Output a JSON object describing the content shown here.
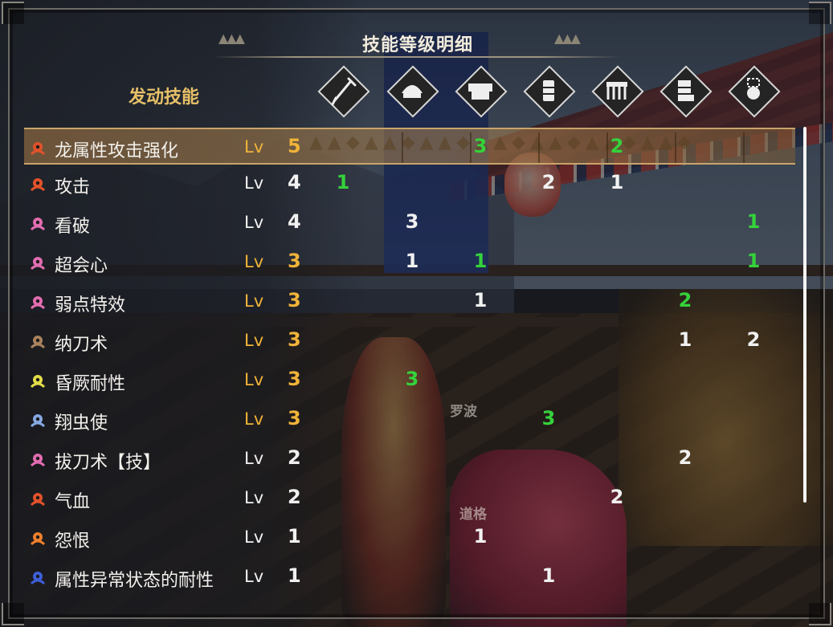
{
  "title": "技能等级明细",
  "section_label": "发动技能",
  "npc_labels": [
    "罗波",
    "道格"
  ],
  "equipment_columns": [
    {
      "icon": "weapon-icon"
    },
    {
      "icon": "helmet-icon"
    },
    {
      "icon": "chest-armor-icon"
    },
    {
      "icon": "arm-armor-icon"
    },
    {
      "icon": "waist-armor-icon"
    },
    {
      "icon": "leg-armor-icon"
    },
    {
      "icon": "talisman-icon"
    }
  ],
  "colors": {
    "level_max": "#f0b339",
    "level_normal": "#f1f1f1",
    "decoration_points": "#35d23b",
    "equipment_points": "#f1f1f1"
  },
  "skills": [
    {
      "name": "龙属性攻击强化",
      "lv_label": "Lv",
      "level": "5",
      "level_style": "gold",
      "icon_color": "#e2522a",
      "highlight": true,
      "points": [
        {
          "col": 2,
          "value": "3",
          "style": "green"
        },
        {
          "col": 4,
          "value": "2",
          "style": "green"
        }
      ]
    },
    {
      "name": "攻击",
      "lv_label": "Lv",
      "level": "4",
      "level_style": "white",
      "icon_color": "#e2522a",
      "highlight": false,
      "points": [
        {
          "col": 0,
          "value": "1",
          "style": "green"
        },
        {
          "col": 3,
          "value": "2",
          "style": "white"
        },
        {
          "col": 4,
          "value": "1",
          "style": "white"
        }
      ]
    },
    {
      "name": "看破",
      "lv_label": "Lv",
      "level": "4",
      "level_style": "white",
      "icon_color": "#e26db0",
      "highlight": false,
      "points": [
        {
          "col": 1,
          "value": "3",
          "style": "white"
        },
        {
          "col": 6,
          "value": "1",
          "style": "green"
        }
      ]
    },
    {
      "name": "超会心",
      "lv_label": "Lv",
      "level": "3",
      "level_style": "gold",
      "icon_color": "#e26db0",
      "highlight": false,
      "points": [
        {
          "col": 1,
          "value": "1",
          "style": "white"
        },
        {
          "col": 2,
          "value": "1",
          "style": "green"
        },
        {
          "col": 6,
          "value": "1",
          "style": "green"
        }
      ]
    },
    {
      "name": "弱点特效",
      "lv_label": "Lv",
      "level": "3",
      "level_style": "gold",
      "icon_color": "#e26db0",
      "highlight": false,
      "points": [
        {
          "col": 2,
          "value": "1",
          "style": "white"
        },
        {
          "col": 5,
          "value": "2",
          "style": "green"
        }
      ]
    },
    {
      "name": "纳刀术",
      "lv_label": "Lv",
      "level": "3",
      "level_style": "gold",
      "icon_color": "#a9825c",
      "highlight": false,
      "points": [
        {
          "col": 5,
          "value": "1",
          "style": "white"
        },
        {
          "col": 6,
          "value": "2",
          "style": "white"
        }
      ]
    },
    {
      "name": "昏厥耐性",
      "lv_label": "Lv",
      "level": "3",
      "level_style": "gold",
      "icon_color": "#e3dd4a",
      "highlight": false,
      "points": [
        {
          "col": 1,
          "value": "3",
          "style": "green"
        }
      ]
    },
    {
      "name": "翔虫使",
      "lv_label": "Lv",
      "level": "3",
      "level_style": "gold",
      "icon_color": "#86a7e2",
      "highlight": false,
      "points": [
        {
          "col": 3,
          "value": "3",
          "style": "green"
        }
      ]
    },
    {
      "name": "拔刀术【技】",
      "lv_label": "Lv",
      "level": "2",
      "level_style": "white",
      "icon_color": "#e26db0",
      "highlight": false,
      "points": [
        {
          "col": 5,
          "value": "2",
          "style": "white"
        }
      ]
    },
    {
      "name": "气血",
      "lv_label": "Lv",
      "level": "2",
      "level_style": "white",
      "icon_color": "#e2522a",
      "highlight": false,
      "points": [
        {
          "col": 4,
          "value": "2",
          "style": "white"
        }
      ]
    },
    {
      "name": "怨恨",
      "lv_label": "Lv",
      "level": "1",
      "level_style": "white",
      "icon_color": "#ef7f2c",
      "highlight": false,
      "points": [
        {
          "col": 2,
          "value": "1",
          "style": "white"
        }
      ]
    },
    {
      "name": "属性异常状态的耐性",
      "lv_label": "Lv",
      "level": "1",
      "level_style": "white",
      "icon_color": "#3e5fd8",
      "highlight": false,
      "points": [
        {
          "col": 3,
          "value": "1",
          "style": "white"
        }
      ]
    }
  ]
}
